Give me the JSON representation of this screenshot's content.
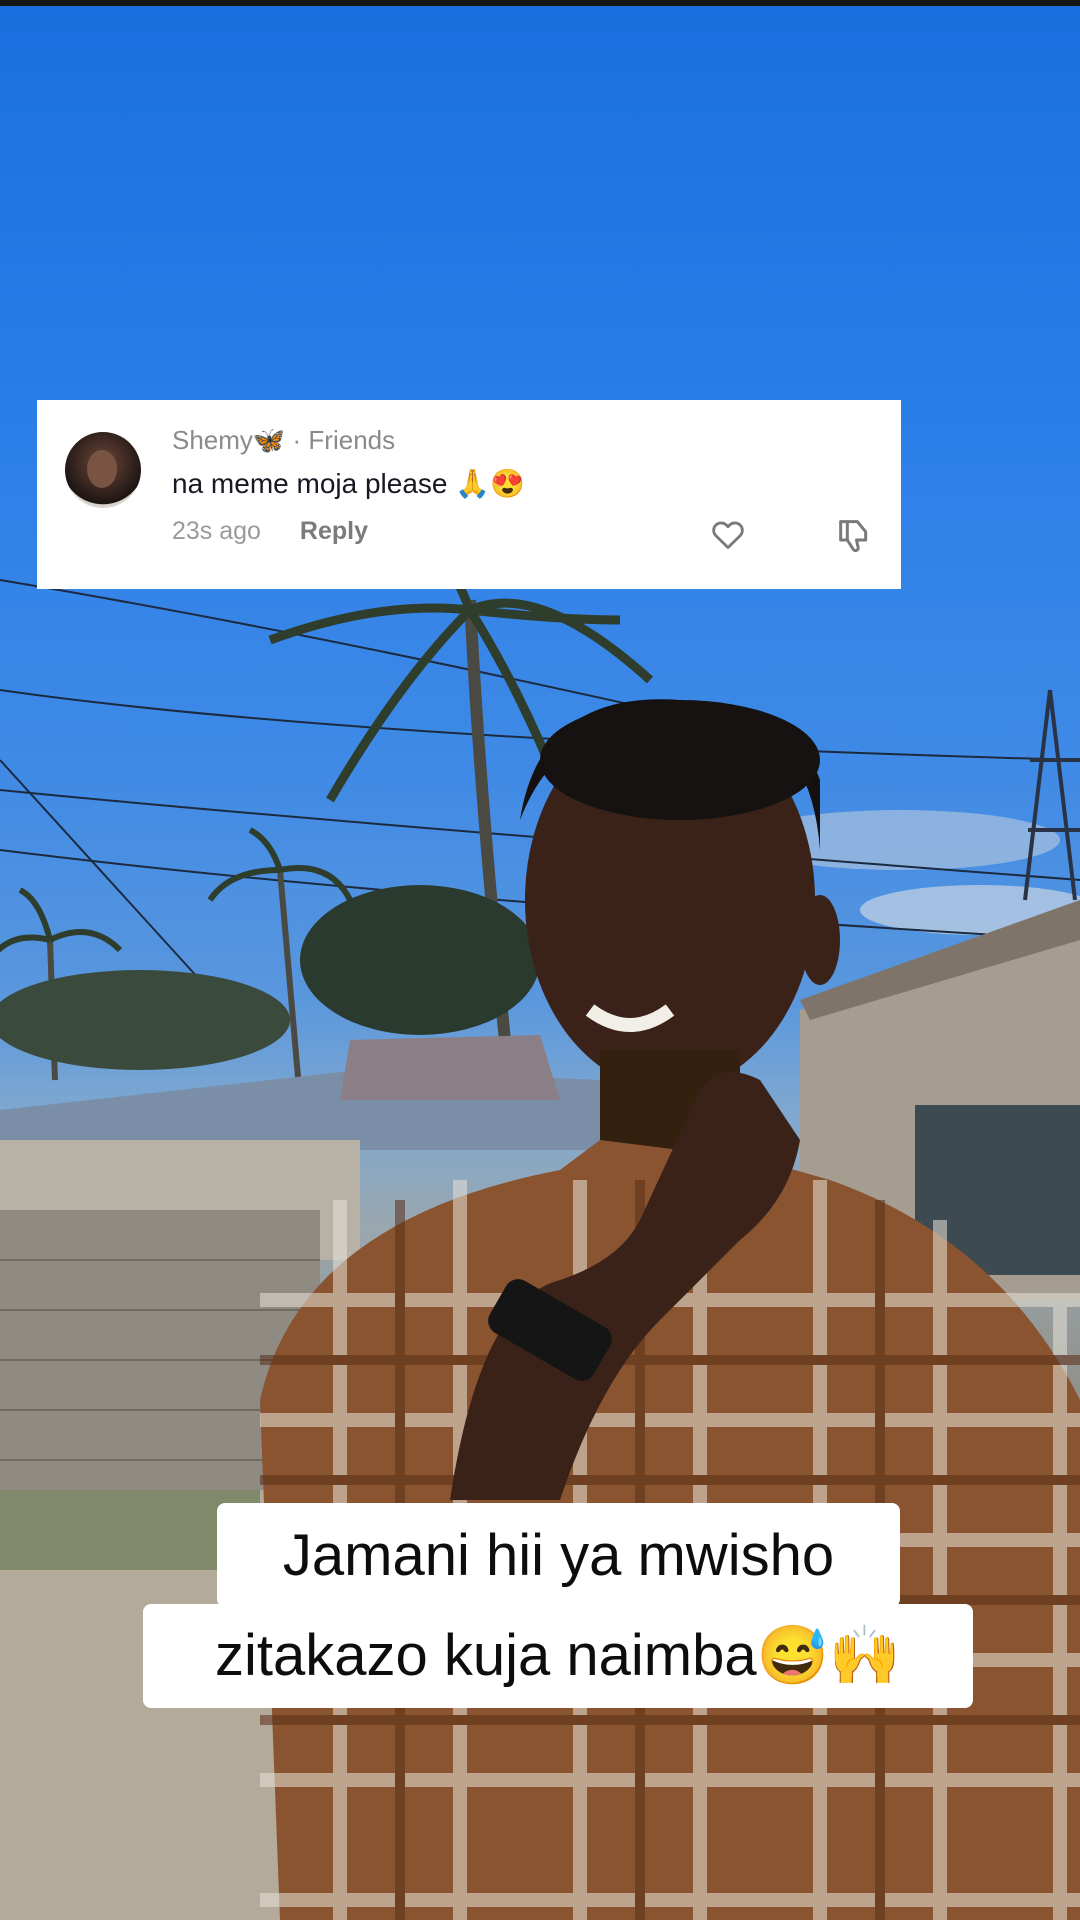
{
  "comment": {
    "username": "Shemy🦋",
    "relation": "· Friends",
    "text": "na meme moja please 🙏😍",
    "time": "23s ago",
    "reply_label": "Reply"
  },
  "caption": {
    "line1": "Jamani hii ya mwisho",
    "line2": "zitakazo kuja naimba😅🙌"
  }
}
